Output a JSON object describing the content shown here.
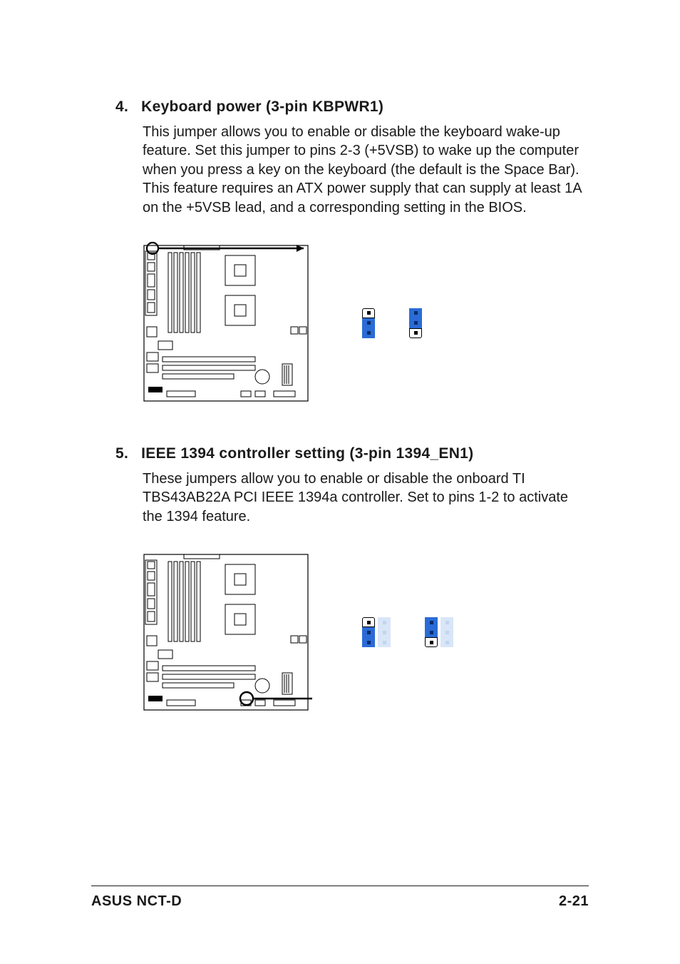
{
  "sections": [
    {
      "num": "4.",
      "title": "Keyboard power (3-pin KBPWR1)",
      "body": "This jumper allows you to enable or disable the keyboard wake-up feature. Set this jumper to pins 2-3 (+5VSB) to wake up the computer when you press a key on the keyboard (the default is the Space Bar). This feature requires an ATX power supply that can supply at least 1A on the +5VSB lead, and a corresponding setting in the BIOS."
    },
    {
      "num": "5.",
      "title": "IEEE 1394 controller setting (3-pin 1394_EN1)",
      "body": "These jumpers allow you to enable or disable the onboard TI TBS43AB22A PCI IEEE 1394a controller. Set to pins 1-2 to activate the 1394 feature."
    }
  ],
  "footer": {
    "left": "ASUS NCT-D",
    "right": "2-21"
  }
}
